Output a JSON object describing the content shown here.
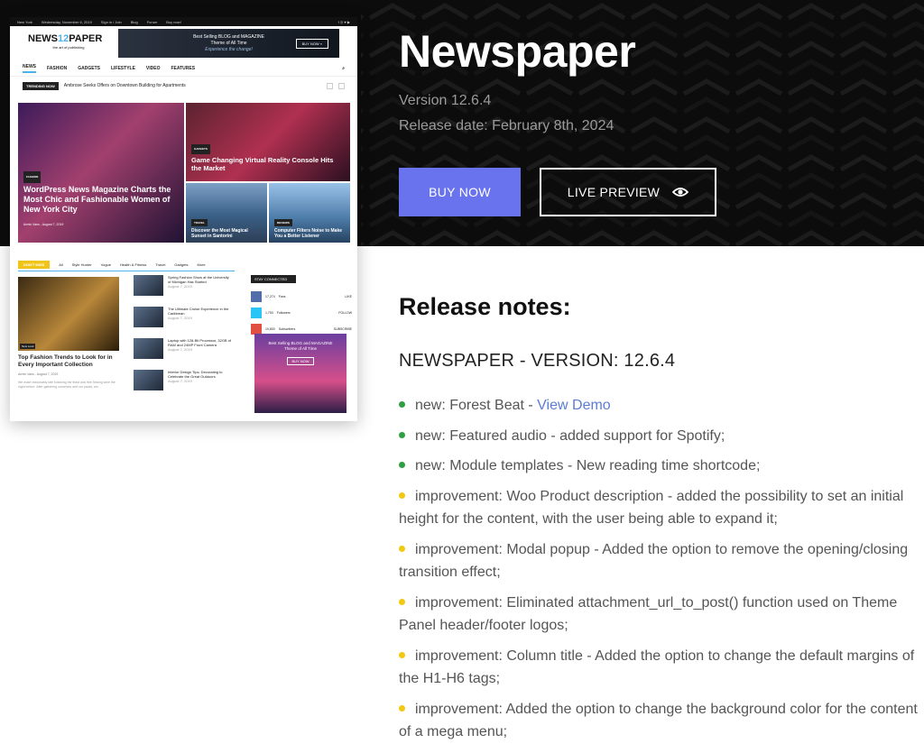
{
  "hero": {
    "title": "Newspaper",
    "version": "Version 12.6.4",
    "release_date": "Release date: February 8th, 2024",
    "buy_label": "BUY NOW",
    "live_label": "LIVE PREVIEW",
    "buy_color": "#6a73ee"
  },
  "preview": {
    "top_location": "New York",
    "top_date": "Wednesday, November 6, 2019",
    "top_links": [
      "Sign in / Join",
      "Blog",
      "Forum",
      "Buy now!"
    ],
    "logo_a": "NEWS",
    "logo_num": "12",
    "logo_b": "PAPER",
    "logo_tag": "the art of publishing",
    "ad_text": "Best Selling BLOG and MAGAZINE Theme of All Time",
    "ad_sub": "Experience the change!",
    "ad_btn": "BUY NOW »",
    "nav": [
      "NEWS",
      "FASHION",
      "GADGETS",
      "LIFESTYLE",
      "VIDEO",
      "FEATURES"
    ],
    "trend_tag": "TRENDING NOW",
    "trend_text": "Ambrose Seeks Offers on Downtown Building for Apartments",
    "main_cat": "FASHION",
    "main_title": "WordPress News Magazine Charts the Most Chic and Fashionable Women of New York City",
    "main_author": "Armin Vans",
    "main_date": "August 7, 2019",
    "g2_cat": "GADGETS",
    "g2_title": "Game Changing Virtual Reality Console Hits the Market",
    "g3_cat": "TRAVEL",
    "g3_title": "Discover the Most Magical Sunset in Santorini",
    "g4_cat": "REVIEWS",
    "g4_title": "Computer Filters Noise to Make You a Better Listener",
    "tabs": [
      "DON'T MISS",
      "All",
      "Style Hunter",
      "Vogue",
      "Health & Fitness",
      "Travel",
      "Gadgets",
      "More"
    ],
    "big_cat": "New Look",
    "big_title": "Top Fashion Trends to Look for in Every Important Collection",
    "big_author": "Armin Vans",
    "big_date": "August 7, 2019",
    "big_excerpt": "We woke reasonably late following the feast and free flowing wine the night before. After gathering ourselves and our packs, we...",
    "small_items": [
      {
        "title": "Spring Fashion Show at the University of Michigan Has Started",
        "date": "August 7, 2019"
      },
      {
        "title": "The Ultimate Cruise Experience in the Caribbean",
        "date": "August 7, 2019"
      },
      {
        "title": "Laptop with 128-Bit Processor, 32GB of RAM and 24MP Front Camera",
        "date": "August 7, 2019"
      },
      {
        "title": "Interior Design Tips: Decorating to Celebrate the Great Outdoors",
        "date": "August 7, 2019"
      }
    ],
    "stay_connected": "STAY CONNECTED",
    "social": [
      {
        "count": "17,274",
        "label": "Fans",
        "action": "LIKE",
        "color": "#516eab"
      },
      {
        "count": "1,753",
        "label": "Followers",
        "action": "FOLLOW",
        "color": "#29c5f6"
      },
      {
        "count": "19,800",
        "label": "Subscribers",
        "action": "SUBSCRIBE",
        "color": "#e14e42"
      }
    ],
    "side_ad": "Best Selling BLOG and MAGAZINE Theme of All Time",
    "side_ad_btn": "BUY NOW"
  },
  "release": {
    "heading": "Release notes:",
    "version_line": "NEWSPAPER - VERSION: 12.6.4",
    "items": [
      {
        "text": "new: Forest Beat - ",
        "link": "View Demo",
        "color": "#2ea043"
      },
      {
        "text": "new: Featured audio - added support for Spotify;",
        "color": "#2ea043"
      },
      {
        "text": "new:  Module templates - New reading time shortcode;",
        "color": "#2ea043"
      },
      {
        "text": "improvement: Woo Product description - added the possibility to set an initial height for the content, with the user being able to expand it;",
        "color": "#f2c811"
      },
      {
        "text": "improvement: Modal popup - Added the option to remove the opening/closing transition effect;",
        "color": "#f2c811"
      },
      {
        "text": "improvement: Eliminated attachment_url_to_post() function used on Theme Panel header/footer logos;",
        "color": "#f2c811"
      },
      {
        "text": "improvement: Column title - Added the option to change the default margins of the H1-H6 tags;",
        "color": "#f2c811"
      },
      {
        "text": "improvement: Added the option to change the background color for the content of a mega menu;",
        "color": "#f2c811"
      }
    ]
  }
}
